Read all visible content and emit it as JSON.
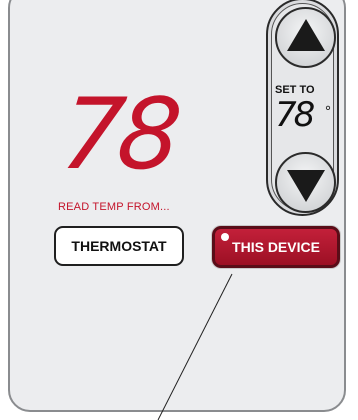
{
  "display": {
    "current_temp": "78",
    "degree_symbol": "°",
    "read_label": "READ TEMP FROM..."
  },
  "buttons": {
    "thermostat_label": "THERMOSTAT",
    "device_label": "THIS DEVICE",
    "device_selected": true
  },
  "setpoint": {
    "label": "SET TO",
    "value": "78",
    "degree_symbol": "°"
  },
  "colors": {
    "accent_red": "#c4142b",
    "button_red": "#b0182f",
    "panel_bg": "#ecedef"
  }
}
